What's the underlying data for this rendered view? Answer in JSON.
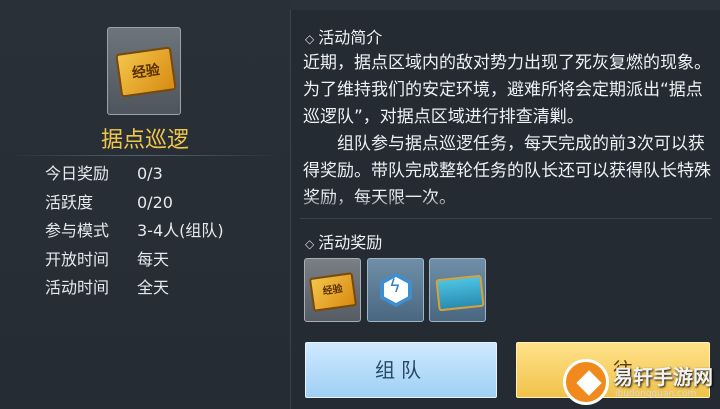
{
  "event": {
    "title": "据点巡逻",
    "item_icon": "exp-ticket-icon",
    "item_label": "经验"
  },
  "stats": [
    {
      "label": "今日奖励",
      "value": "0/3"
    },
    {
      "label": "活跃度",
      "value": "0/20"
    },
    {
      "label": "参与模式",
      "value": "3-4人(组队)"
    },
    {
      "label": "开放时间",
      "value": "每天"
    },
    {
      "label": "活动时间",
      "value": "全天"
    }
  ],
  "intro": {
    "heading": "活动简介",
    "paragraph1": "近期，据点区域内的敌对势力出现了死灰复燃的现象。为了维持我们的安定环境，避难所将会定期派出“据点巡逻队”，对据点区域进行排查清剿。",
    "paragraph2": "组队参与据点巡逻任务，每天完成的前3次可以获得奖励。带队完成整轮任务的队长还可以获得队长特殊奖励，每天限一次。"
  },
  "rewards": {
    "heading": "活动奖励",
    "items": [
      {
        "icon": "exp-ticket-icon",
        "label": "经验"
      },
      {
        "icon": "energy-hex-icon"
      },
      {
        "icon": "supply-chest-icon"
      }
    ]
  },
  "buttons": {
    "team": "组队",
    "go": "前往"
  },
  "watermark": {
    "name": "易轩手游网",
    "url": "ibudongguan.com"
  }
}
